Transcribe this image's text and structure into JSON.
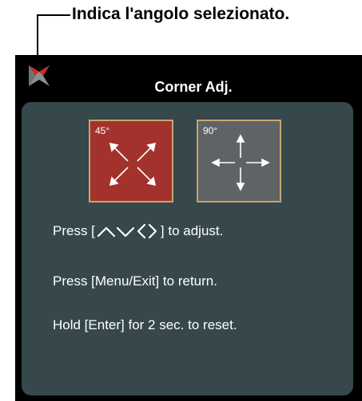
{
  "callout": {
    "text": "Indica l'angolo selezionato."
  },
  "osd": {
    "title": "Corner Adj.",
    "angles": [
      {
        "label": "45°",
        "selected": true
      },
      {
        "label": "90°",
        "selected": false
      }
    ],
    "instructions": {
      "press_prefix": "Press [",
      "press_suffix": "] to adjust.",
      "menu_exit": "Press [Menu/Exit] to return.",
      "hold_enter": "Hold [Enter] for 2 sec. to reset."
    },
    "icons": {
      "corner_indicator": "corner-selector-icon",
      "arrows": "up-down-left-right-icons"
    },
    "colors": {
      "selected_box": "#a3322c",
      "unselected_box": "#5e6466",
      "box_border": "#c9a46f",
      "panel_bg": "#36484b",
      "indicator_accent": "#c8312b"
    }
  }
}
